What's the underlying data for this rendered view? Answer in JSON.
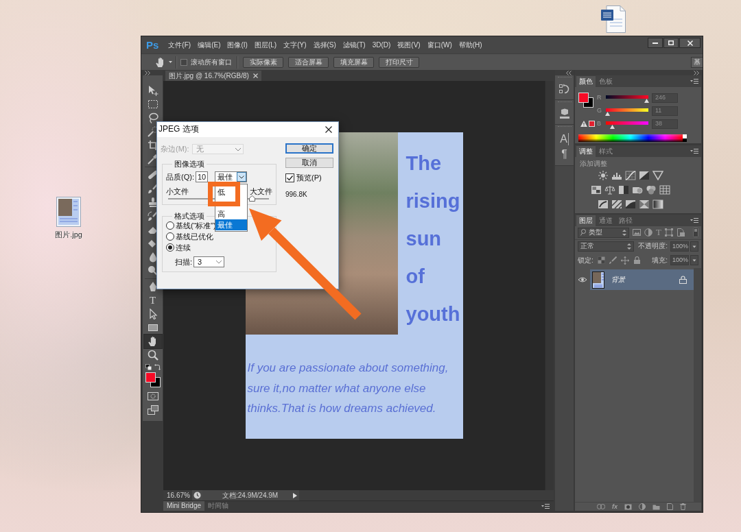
{
  "desktop": {
    "icons": [
      {
        "kind": "image",
        "label": "图片.jpg"
      },
      {
        "kind": "document"
      }
    ]
  },
  "window": {
    "logo": "Ps",
    "menu": [
      "文件(F)",
      "编辑(E)",
      "图像(I)",
      "图层(L)",
      "文字(Y)",
      "选择(S)",
      "滤镜(T)",
      "3D(D)",
      "视图(V)",
      "窗口(W)",
      "帮助(H)"
    ]
  },
  "options_bar": {
    "scroll_all": {
      "label": "滚动所有窗口",
      "checked": false
    },
    "buttons": [
      "实际像素",
      "适合屏幕",
      "填充屏幕",
      "打印尺寸"
    ],
    "workspace": "基"
  },
  "tools": {
    "groups": [
      [
        {
          "kind": "move",
          "selected": false
        },
        {
          "kind": "marquee",
          "selected": false
        },
        {
          "kind": "lasso",
          "selected": false
        },
        {
          "kind": "quick_select",
          "selected": false
        },
        {
          "kind": "crop",
          "selected": false
        },
        {
          "kind": "eyedropper",
          "selected": false
        }
      ],
      [
        {
          "kind": "healing",
          "selected": false
        },
        {
          "kind": "brush",
          "selected": false
        },
        {
          "kind": "stamp",
          "selected": false
        },
        {
          "kind": "history_brush",
          "selected": false
        },
        {
          "kind": "eraser",
          "selected": false
        },
        {
          "kind": "bucket",
          "selected": false
        },
        {
          "kind": "blur",
          "selected": false
        },
        {
          "kind": "dodge",
          "selected": false
        }
      ],
      [
        {
          "kind": "pen",
          "selected": false
        },
        {
          "kind": "type",
          "glyph": "T",
          "selected": false
        },
        {
          "kind": "path_select",
          "selected": false
        },
        {
          "kind": "shape",
          "selected": false
        },
        {
          "kind": "hand",
          "selected": true
        },
        {
          "kind": "zoom",
          "selected": false
        }
      ]
    ],
    "swatches": [
      {
        "kind": "foreground",
        "color": "#f60b26"
      },
      {
        "kind": "background",
        "color": "#000000"
      }
    ]
  },
  "document": {
    "tab": "图片.jpg @ 16.7%(RGB/8)",
    "poster": {
      "title": "The rising sun of youth",
      "quote": "If you are passionate about something, sure it,no matter what anyone else thinks.That is how dreams achieved."
    },
    "zoom": "16.67%",
    "info": "文档:24.9M/24.9M"
  },
  "bottom_tabs": [
    {
      "label": "Mini Bridge",
      "selected": true
    },
    {
      "label": "时间轴",
      "selected": false
    }
  ],
  "dock": [
    [
      {
        "kind": "history"
      }
    ],
    [
      {
        "kind": "properties"
      }
    ],
    [
      {
        "kind": "character",
        "glyph": "A"
      },
      {
        "kind": "paragraph",
        "glyph": "¶"
      }
    ]
  ],
  "panels": {
    "color": {
      "tabs": [
        {
          "label": "颜色",
          "selected": true
        },
        {
          "label": "色板",
          "selected": false
        }
      ],
      "swatches": [
        {
          "kind": "foreground",
          "color": "#f60b26"
        },
        {
          "kind": "background",
          "color": "#000000"
        },
        {
          "kind": "gamut",
          "color": "#e3202f"
        }
      ],
      "channels": [
        {
          "name": "R",
          "value": "246",
          "level": 0.96
        },
        {
          "name": "G",
          "value": "11",
          "level": 0.04
        },
        {
          "name": "B",
          "value": "38",
          "level": 0.15
        }
      ]
    },
    "adjustments": {
      "tabs": [
        {
          "label": "调整",
          "selected": true
        },
        {
          "label": "样式",
          "selected": false
        }
      ],
      "hint": "添加调整"
    },
    "layers": {
      "tabs": [
        {
          "label": "图层",
          "selected": true
        },
        {
          "label": "通道",
          "selected": false
        },
        {
          "label": "路径",
          "selected": false
        }
      ],
      "filter": "类型",
      "filters": [
        {
          "kind": "pixel"
        },
        {
          "kind": "adjustment"
        },
        {
          "kind": "type",
          "glyph": "T"
        },
        {
          "kind": "shape"
        },
        {
          "kind": "smart"
        }
      ],
      "blend_mode": "正常",
      "opacity_label": "不透明度:",
      "opacity": {
        "value": "100%",
        "disabled": true
      },
      "lock_label": "锁定:",
      "fill_label": "填充:",
      "fill": {
        "value": "100%",
        "disabled": true
      },
      "rows": [
        {
          "name": "背景",
          "visible": true,
          "locked": true,
          "selected": true
        }
      ],
      "effects_label": "fx"
    }
  },
  "dialog": {
    "title": "JPEG 选项",
    "matte": {
      "label": "杂边(M):",
      "value": "无",
      "disabled": true
    },
    "image_options": {
      "legend": "图像选项",
      "quality_label": "品质(Q):",
      "quality": "10",
      "preset": "最佳",
      "small_label": "小文件",
      "large_label": "大文件",
      "level": 0.83
    },
    "dropdown": {
      "open": true,
      "items": [
        {
          "label": "低",
          "selected": false
        },
        {
          "label": "高",
          "selected": false
        },
        {
          "label": "最佳",
          "selected": true
        }
      ]
    },
    "format_options": {
      "legend": "格式选项",
      "radios": [
        {
          "label": "基线(“标准”)",
          "selected": false
        },
        {
          "label": "基线已优化",
          "selected": false
        },
        {
          "label": "连续",
          "selected": true
        }
      ],
      "scans_label": "扫描:",
      "scans": "3"
    },
    "buttons": [
      {
        "label": "确定",
        "default": true
      },
      {
        "label": "取消",
        "default": false
      }
    ],
    "preview": {
      "label": "预览(P)",
      "checked": true
    },
    "size": "996.8K"
  },
  "annotations": {
    "highlight_frame": true,
    "pointer_arrow": true
  }
}
